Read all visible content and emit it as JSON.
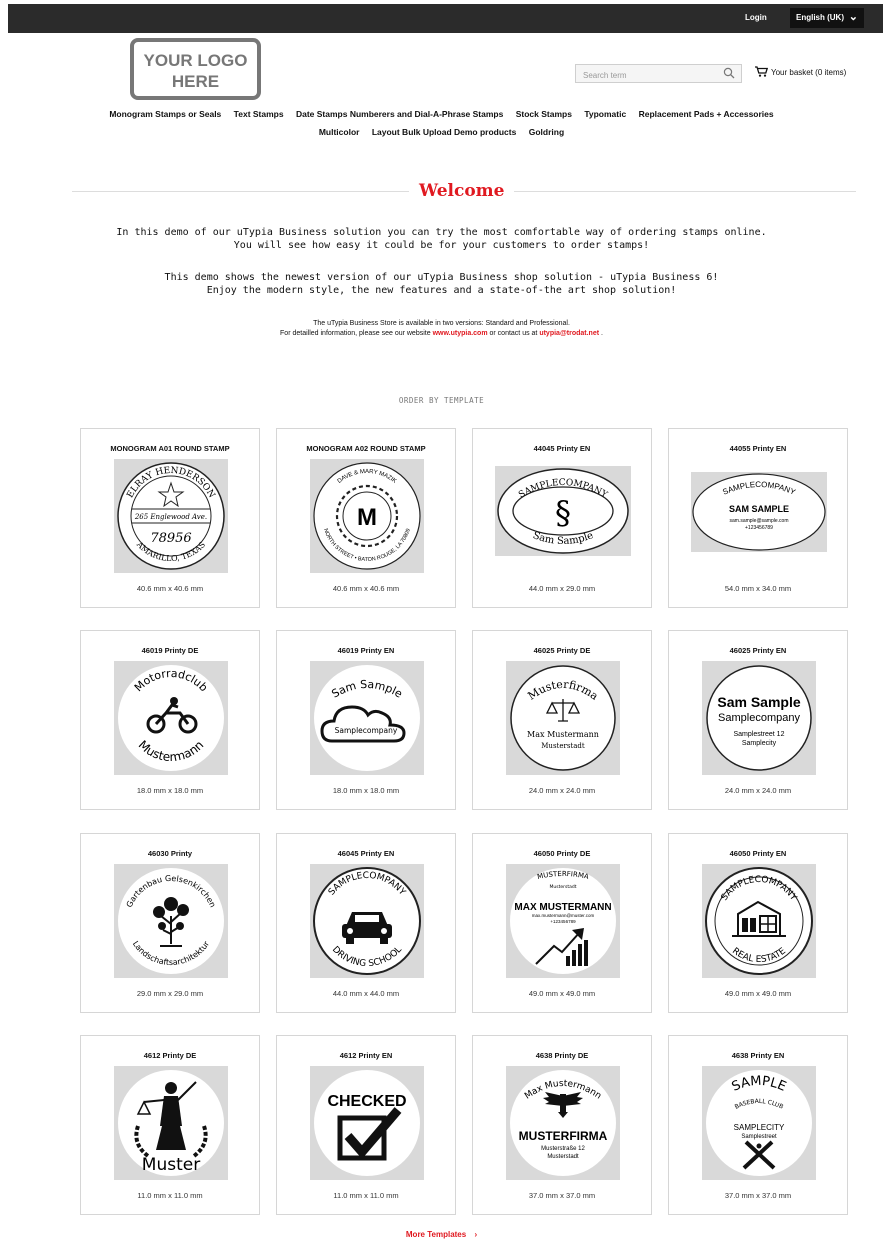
{
  "topbar": {
    "login": "Login",
    "language": "English (UK)"
  },
  "logo": {
    "line1": "YOUR LOGO",
    "line2": "HERE"
  },
  "search": {
    "placeholder": "Search term"
  },
  "basket": {
    "label": "Your basket (0 items)"
  },
  "nav": {
    "row1": [
      "Monogram Stamps or Seals",
      "Text Stamps",
      "Date Stamps Numberers and Dial-A-Phrase Stamps",
      "Stock Stamps",
      "Typomatic",
      "Replacement Pads + Accessories"
    ],
    "row2": [
      "Multicolor",
      "Layout Bulk Upload Demo products",
      "Goldring"
    ]
  },
  "welcome": {
    "title": "Welcome"
  },
  "intro": {
    "p1_line1": "In this demo of our uTypia Business solution you can try the most comfortable way of ordering stamps online.",
    "p1_line2": "You will see how easy it could be for your customers to order stamps!",
    "p2_line1": "This demo shows the newest version of our uTypia Business shop solution - uTypia Business 6!",
    "p2_line2": "Enjoy the modern style, the new features and a state-of-the art shop solution!",
    "s1": "The uTypia Business Store is available in two versions: Standard and Professional.",
    "s2_pre": "For detailled information, please see our website",
    "s2_link1": "www.utypia.com",
    "s2_mid": "or contact us at",
    "s2_link2": "utypia@trodat.net",
    "s2_post": "."
  },
  "order_by": "ORDER BY TEMPLATE",
  "templates": [
    {
      "title": "MONOGRAM A01 ROUND STAMP",
      "size": "40.6 mm x 40.6 mm"
    },
    {
      "title": "MONOGRAM A02 ROUND STAMP",
      "size": "40.6 mm x 40.6 mm"
    },
    {
      "title": "44045 Printy EN",
      "size": "44.0 mm x 29.0 mm"
    },
    {
      "title": "44055 Printy EN",
      "size": "54.0 mm x 34.0 mm"
    },
    {
      "title": "46019 Printy DE",
      "size": "18.0 mm x 18.0 mm"
    },
    {
      "title": "46019 Printy EN",
      "size": "18.0 mm x 18.0 mm"
    },
    {
      "title": "46025 Printy DE",
      "size": "24.0 mm x 24.0 mm"
    },
    {
      "title": "46025 Printy EN",
      "size": "24.0 mm x 24.0 mm"
    },
    {
      "title": "46030 Printy",
      "size": "29.0 mm x 29.0 mm"
    },
    {
      "title": "46045 Printy EN",
      "size": "44.0 mm x 44.0 mm"
    },
    {
      "title": "46050 Printy DE",
      "size": "49.0 mm x 49.0 mm"
    },
    {
      "title": "46050 Printy EN",
      "size": "49.0 mm x 49.0 mm"
    },
    {
      "title": "4612 Printy DE",
      "size": "11.0 mm x 11.0 mm"
    },
    {
      "title": "4612 Printy EN",
      "size": "11.0 mm x 11.0 mm"
    },
    {
      "title": "4638 Printy DE",
      "size": "37.0 mm x 37.0 mm"
    },
    {
      "title": "4638 Printy EN",
      "size": "37.0 mm x 37.0 mm"
    }
  ],
  "stamp_text": {
    "t0": {
      "arc_top": "ELRAY HENDERSON",
      "line": "265 Englewood Ave.",
      "num": "78956",
      "arc_bottom": "AMARILLO, TEXAS"
    },
    "t1": {
      "letter": "M",
      "arc_top": "DAVE & MARY MAZIK",
      "arc_bottom": "NORTH STREET • BATON ROUGE, LA 70809"
    },
    "t2": {
      "top": "SAMPLECOMPANY",
      "symbol": "§",
      "bottom": "Sam Sample"
    },
    "t3": {
      "top": "SAMPLECOMPANY",
      "name": "SAM SAMPLE",
      "l1": "sam.sample@sample.com",
      "l2": "+123456789"
    },
    "t4": {
      "top": "Motorradclub",
      "bottom": "Mustermann"
    },
    "t5": {
      "top": "Sam Sample",
      "cloud": "Samplecompany"
    },
    "t6": {
      "top": "Musterfirma",
      "l1": "Max Mustermann",
      "l2": "Musterstadt"
    },
    "t7": {
      "l1": "Sam Sample",
      "l2": "Samplecompany",
      "l3": "Samplestreet 12",
      "l4": "Samplecity"
    },
    "t8": {
      "top": "Gartenbau Gelsenkirchen",
      "bottom": "Landschaftsarchitektur"
    },
    "t9": {
      "top": "SAMPLECOMPANY",
      "bottom": "DRIVING SCHOOL"
    },
    "t10": {
      "l0": "MUSTERFIRMA",
      "l0b": "Musterstadt",
      "name": "MAX MUSTERMANN",
      "l1": "max.mustermann@muster.com",
      "l2": "+123456789"
    },
    "t11": {
      "top": "SAMPLECOMPANY",
      "bottom": "REAL ESTATE"
    },
    "t12": {
      "bottom": "Muster"
    },
    "t13": {
      "top": "CHECKED"
    },
    "t14": {
      "top": "Max Mustermann",
      "name": "MUSTERFIRMA",
      "l1": "Musterstraße 12",
      "l2": "Musterstadt"
    },
    "t15": {
      "top": "SAMPLE",
      "sub": "BASEBALL CLUB",
      "l1": "SAMPLECITY",
      "l2": "Samplestreet"
    }
  },
  "more_templates": "More Templates"
}
